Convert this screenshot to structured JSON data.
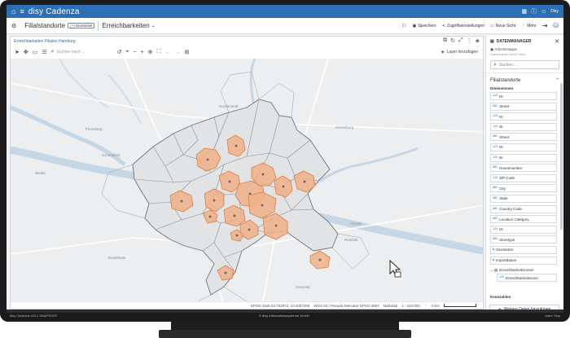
{
  "app": {
    "title": "disy Cadenza",
    "user": "Disy"
  },
  "workspace": {
    "name": "Filialstandorte",
    "badge": "(+) Bearbeitet",
    "view": "Erreichbarkeiten"
  },
  "toolbar_actions": [
    "Speichern",
    "Zugriffseinstellungen",
    "Neue Sicht",
    "Mehr"
  ],
  "map": {
    "title": "Erreichbarkeiten Filialen Hamburg",
    "search_placeholder": "Suchen nach ...",
    "layers_label": "Layer hinzufügen",
    "places": [
      "Norderstedt",
      "Ahrensburg",
      "Schenefeld",
      "Wedel",
      "Pinneberg",
      "Seevetal",
      "Buxtehude",
      "Glinde",
      "Reinbek"
    ],
    "status": {
      "coords": "EPSG:4326 53.752973, 10.4057200",
      "wgs": "WGS 84 / Pseudo-Mercator EPSG:3857",
      "scale_label": "Maßstab",
      "scale_value": "1 : 310.000",
      "distance": "8 km"
    }
  },
  "panel": {
    "title": "DATENMANAGER",
    "sub_title": "Arbeitsmappe",
    "sub_note": "Datenmappe dieser Sicht",
    "search_placeholder": "Suchen ...",
    "section": "Filialstandorte",
    "dimensions_label": "Dimensionen",
    "items": [
      {
        "type": "123",
        "label": "ID"
      },
      {
        "type": "ABC",
        "label": "Street"
      },
      {
        "type": "123",
        "label": "ID"
      },
      {
        "type": "123",
        "label": "Nr"
      },
      {
        "type": "ABC",
        "label": "Street"
      },
      {
        "type": "123",
        "label": "ID"
      },
      {
        "type": "123",
        "label": "Nr"
      },
      {
        "type": "ABC",
        "label": "Housenumber"
      },
      {
        "type": "123",
        "label": "ZIP Code"
      },
      {
        "type": "ABC",
        "label": "City"
      },
      {
        "type": "ABC",
        "label": "State"
      },
      {
        "type": "ABC",
        "label": "Country Code"
      },
      {
        "type": "ABC",
        "label": "Location Category"
      },
      {
        "type": "123",
        "label": "ID"
      },
      {
        "type": "ABC",
        "label": "Storetype"
      },
      {
        "type": "",
        "label": "Geometrie"
      },
      {
        "type": "",
        "label": "Importdatum"
      }
    ],
    "group_label": "Erreichbarkeitszonen",
    "group_item": {
      "type": "123",
      "label": "Erreichbarkeitszone"
    },
    "kennzahlen_label": "Kennzahlen",
    "add_button": "Weitere Daten hinzufügen"
  },
  "footer": {
    "left": "disy Cadenza v10.1 SNAPSHOT",
    "center": "© disy Informationssysteme GmbH",
    "right": "User: Disy"
  },
  "colors": {
    "brand": "#2d6fb5",
    "zone_fill": "#f0b088",
    "zone_stroke": "#d77f47",
    "water": "#c5d6e6"
  }
}
